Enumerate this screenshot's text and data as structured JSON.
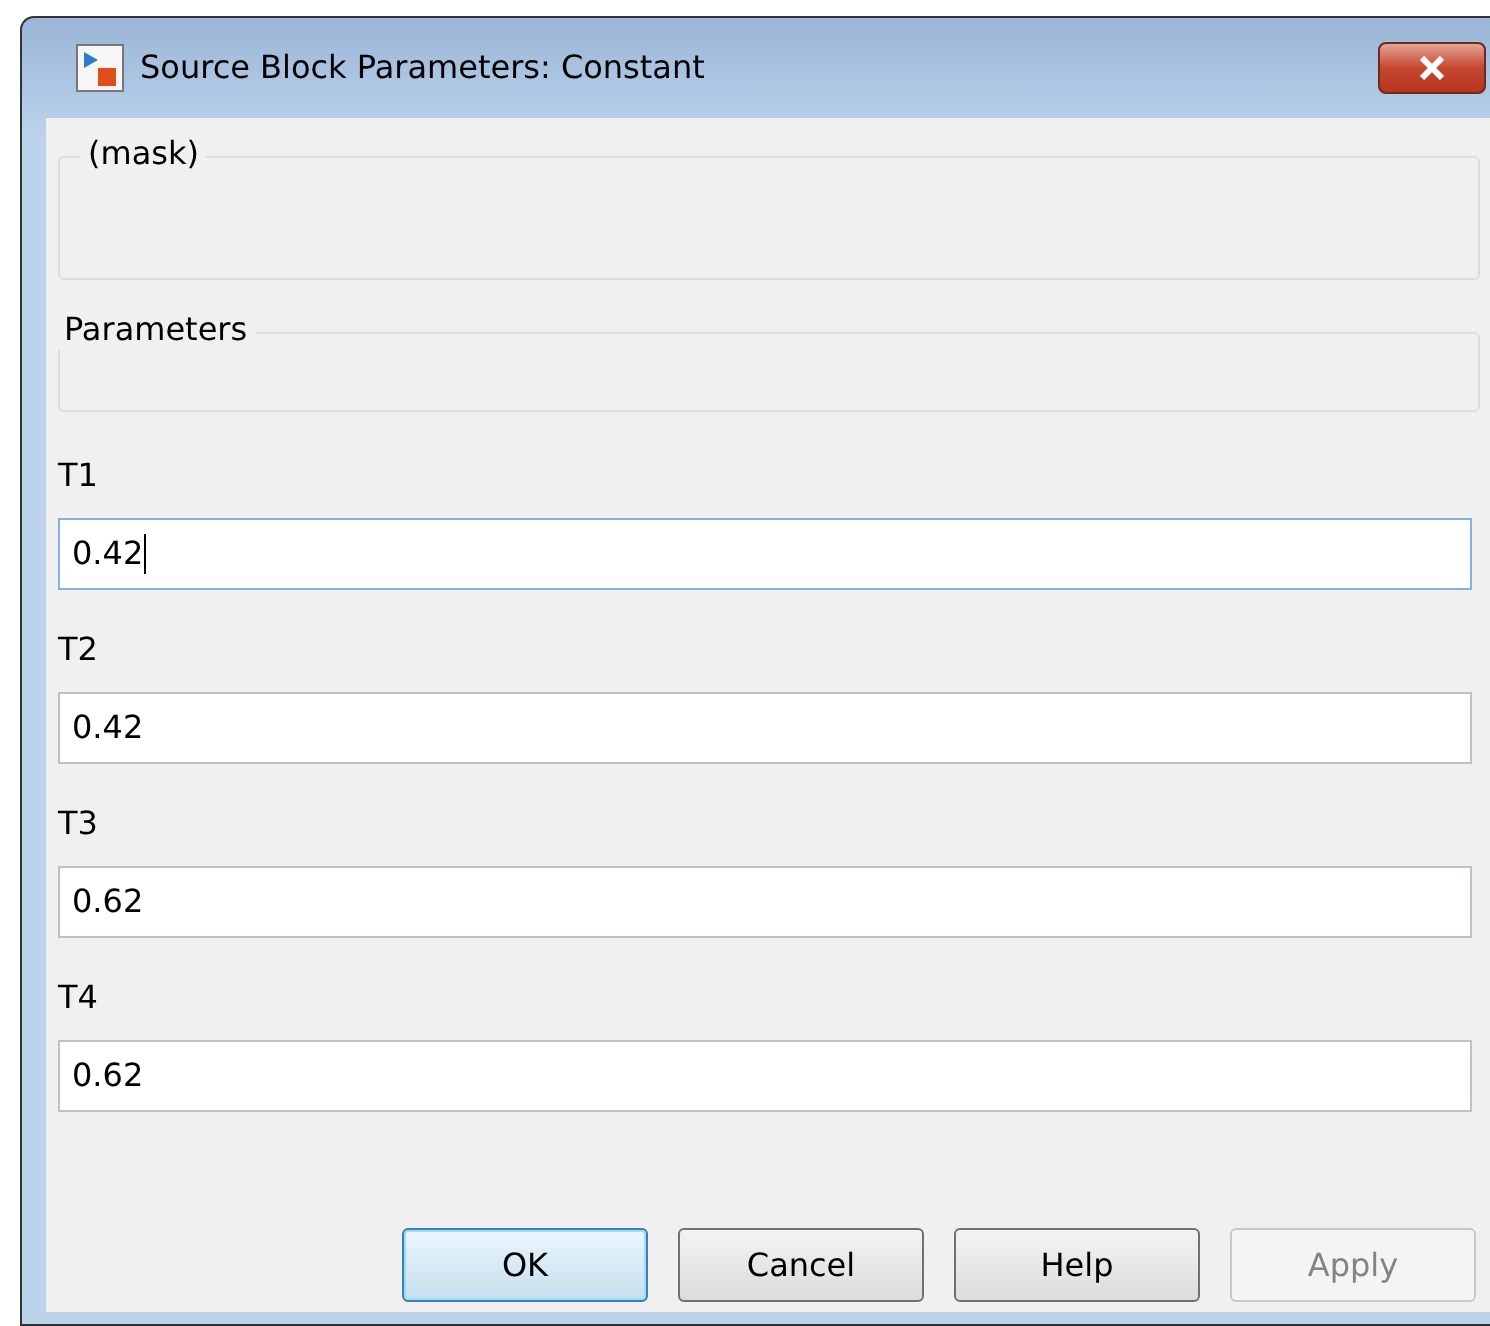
{
  "window": {
    "title": "Source Block Parameters: Constant"
  },
  "groups": [
    {
      "title": "(mask)"
    },
    {
      "title": "Parameters"
    }
  ],
  "fields": [
    {
      "label": "T1",
      "value": "0.42",
      "focused": true
    },
    {
      "label": "T2",
      "value": "0.42",
      "focused": false
    },
    {
      "label": "T3",
      "value": "0.62",
      "focused": false
    },
    {
      "label": "T4",
      "value": "0.62",
      "focused": false
    }
  ],
  "buttons": [
    {
      "label": "OK",
      "default": true,
      "disabled": false
    },
    {
      "label": "Cancel",
      "default": false,
      "disabled": false
    },
    {
      "label": "Help",
      "default": false,
      "disabled": false
    },
    {
      "label": "Apply",
      "default": false,
      "disabled": true
    }
  ]
}
